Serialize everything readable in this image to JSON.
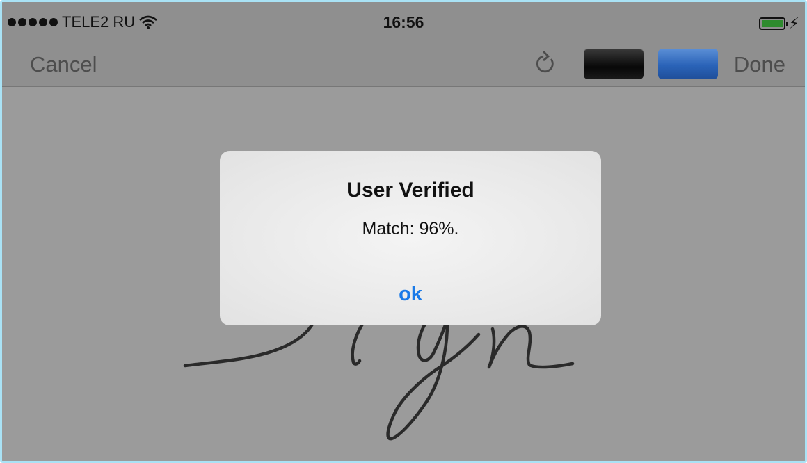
{
  "status_bar": {
    "carrier": "TELE2 RU",
    "time": "16:56"
  },
  "nav_bar": {
    "cancel_label": "Cancel",
    "done_label": "Done"
  },
  "pen_colors": [
    "#000000",
    "#2a63b8"
  ],
  "alert": {
    "title": "User Verified",
    "message": "Match: 96%.",
    "button_label": "ok"
  },
  "icons": [
    "wifi-icon",
    "battery-icon",
    "charging-icon",
    "refresh-icon"
  ]
}
